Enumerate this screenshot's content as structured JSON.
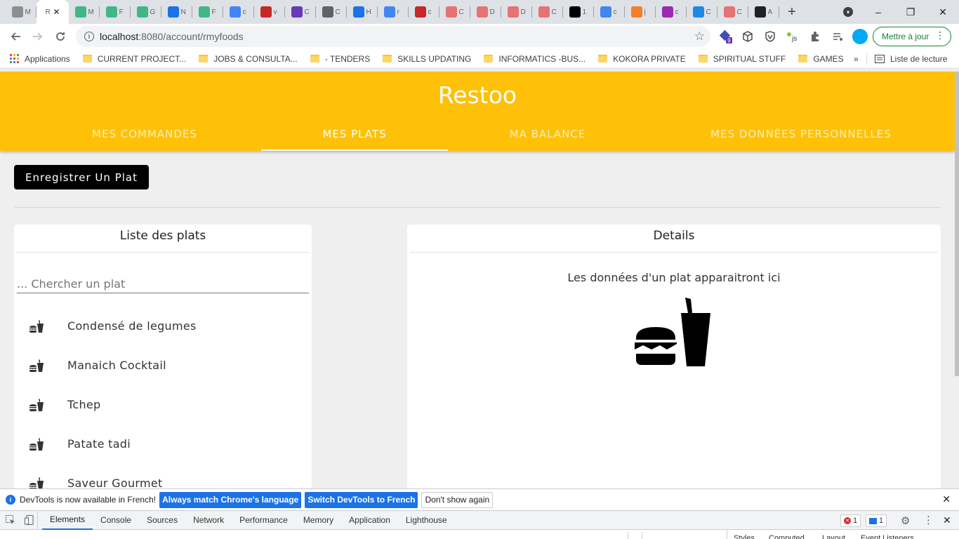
{
  "browser": {
    "tabs": [
      {
        "letter": "M",
        "color": "#8e8e8e"
      },
      {
        "letter": "R",
        "color": "#ffc107"
      },
      {
        "letter": "M",
        "color": "#41b883"
      },
      {
        "letter": "F",
        "color": "#41b883"
      },
      {
        "letter": "G",
        "color": "#41b883"
      },
      {
        "letter": "N",
        "color": "#1a73e8"
      },
      {
        "letter": "F",
        "color": "#41b883"
      },
      {
        "letter": "c",
        "color": "#4285f4"
      },
      {
        "letter": "v",
        "color": "#c62828"
      },
      {
        "letter": "C",
        "color": "#673ab7"
      },
      {
        "letter": "C",
        "color": "#5f6368"
      },
      {
        "letter": "H",
        "color": "#1a73e8"
      },
      {
        "letter": "r",
        "color": "#4285f4"
      },
      {
        "letter": "c",
        "color": "#c62828"
      },
      {
        "letter": "C",
        "color": "#e57373"
      },
      {
        "letter": "D",
        "color": "#e57373"
      },
      {
        "letter": "D",
        "color": "#e57373"
      },
      {
        "letter": "C",
        "color": "#e57373"
      },
      {
        "letter": "1",
        "color": "#000000"
      },
      {
        "letter": "c",
        "color": "#4285f4"
      },
      {
        "letter": "j",
        "color": "#f48024"
      },
      {
        "letter": "c",
        "color": "#9c27b0"
      },
      {
        "letter": "C",
        "color": "#1e88e5"
      },
      {
        "letter": "C",
        "color": "#e57373"
      },
      {
        "letter": "A",
        "color": "#202124"
      }
    ],
    "new_tab": "+",
    "tab_search": "▾",
    "minimize": "–",
    "maximize": "❐",
    "close": "✕",
    "tab_close": "✕",
    "url_host": "localhost",
    "url_rest": ":8080/account/rmyfoods",
    "update_label": "Mettre à jour",
    "ext_badge": "9",
    "bookmarks": [
      {
        "label": "Applications",
        "type": "apps"
      },
      {
        "label": "CURRENT PROJECT...",
        "type": "folder"
      },
      {
        "label": "JOBS & CONSULTA...",
        "type": "folder"
      },
      {
        "label": "- TENDERS",
        "type": "folder"
      },
      {
        "label": "SKILLS UPDATING",
        "type": "folder"
      },
      {
        "label": "INFORMATICS -BUS...",
        "type": "folder"
      },
      {
        "label": "KOKORA PRIVATE",
        "type": "folder"
      },
      {
        "label": "SPIRITUAL STUFF",
        "type": "folder"
      },
      {
        "label": "GAMES",
        "type": "folder"
      }
    ],
    "bookmarks_more": "»",
    "reading_list": "Liste de lecture"
  },
  "app": {
    "title": "Restoo",
    "nav_tabs": [
      {
        "label": "MES COMMANDES",
        "active": false
      },
      {
        "label": "MES PLATS",
        "active": true
      },
      {
        "label": "MA BALANCE",
        "active": false
      },
      {
        "label": "MES DONNÉES PERSONNELLES",
        "active": false
      }
    ],
    "register_button": "Enregistrer Un Plat",
    "list_card": {
      "title": "Liste des plats",
      "search_placeholder": "... Chercher un plat",
      "items": [
        "Condensé de legumes",
        "Manaich Cocktail",
        "Tchep",
        "Patate tadi",
        "Saveur Gourmet"
      ]
    },
    "details_card": {
      "title": "Details",
      "empty_message": "Les données d'un plat apparaitront ici"
    },
    "accent_color": "#ffc107"
  },
  "devtools": {
    "info_message": "DevTools is now available in French!",
    "btn_match": "Always match Chrome's language",
    "btn_switch": "Switch DevTools to French",
    "btn_dismiss": "Don't show again",
    "tabs": [
      "Elements",
      "Console",
      "Sources",
      "Network",
      "Performance",
      "Memory",
      "Application",
      "Lighthouse"
    ],
    "error_count": "1",
    "message_count": "1",
    "sidebar_tabs": [
      "Styles",
      "Computed",
      "Layout",
      "Event Listeners"
    ]
  }
}
